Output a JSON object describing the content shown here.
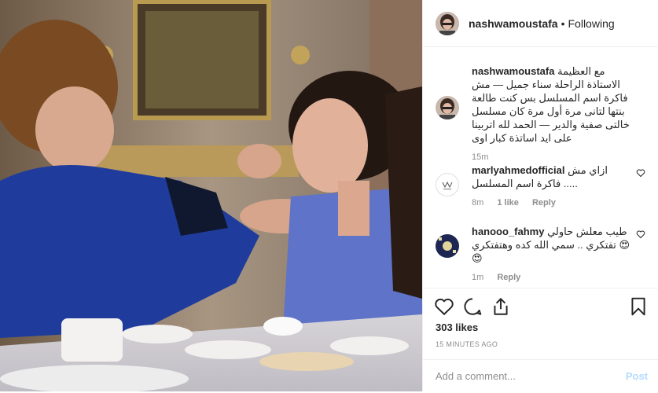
{
  "header": {
    "username": "nashwamoustafa",
    "separator": "•",
    "follow_status": "Following"
  },
  "caption": {
    "username": "nashwamoustafa",
    "text": "مع العظيمة الاستاذة الراحلة سناء جميل — مش فاكرة اسم المسلسل بس كنت طالعة بنتها لتانى مرة أول مرة كان مسلسل خالتى صفية والدير — الحمد لله اتربينا على ايد اساتذة كبار اوى",
    "time": "15m"
  },
  "comments": [
    {
      "username": "marlyahmedofficial",
      "text": "ازاي مش فاكرة اسم المسلسل .....",
      "time": "8m",
      "likes": "1 like",
      "reply": "Reply"
    },
    {
      "username": "hanooo_fahmy",
      "text": "طيب معلش حاولي تفتكري .. سمي الله كده وهتفتكري 😍😍",
      "time": "1m",
      "reply": "Reply"
    }
  ],
  "actions": {
    "likes": "303 likes",
    "timestamp": "15 MINUTES AGO",
    "add_comment_placeholder": "Add a comment...",
    "post_label": "Post"
  },
  "colors": {
    "border": "#efefef",
    "muted": "#8e8e8e",
    "text": "#262626",
    "post_disabled": "#b3dbff"
  },
  "icons": [
    "heart-icon",
    "comment-icon",
    "share-icon",
    "bookmark-icon"
  ]
}
